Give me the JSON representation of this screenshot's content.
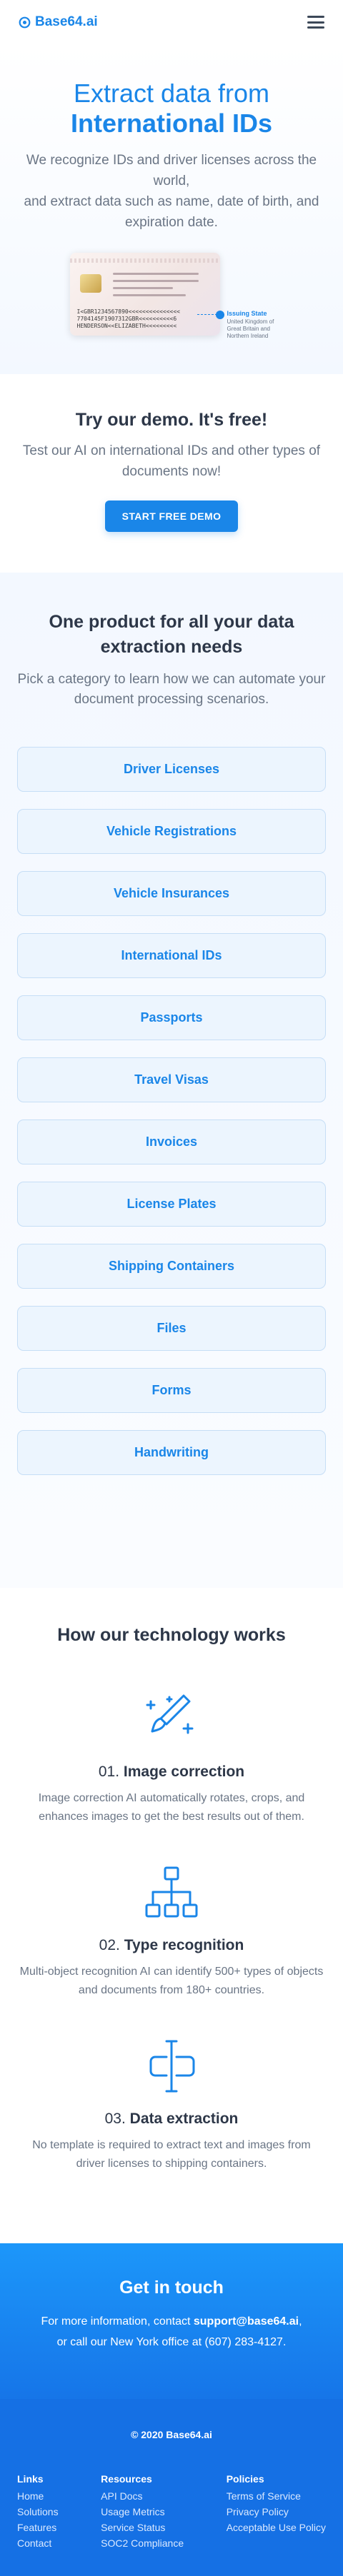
{
  "header": {
    "brand": "Base64.ai",
    "logo_icon": "base64-logo-icon",
    "menu_icon": "hamburger-menu-icon"
  },
  "hero": {
    "title_line1": "Extract data from",
    "title_line2": "International IDs",
    "description": "We recognize IDs and driver licenses across the world,\nand extract data such as name, date of birth, and expiration date.",
    "card": {
      "mrz_line1": "I<GBR1234567890<<<<<<<<<<<<<<<",
      "mrz_line2": "7704145F1907312GBR<<<<<<<<<<6",
      "mrz_line3": "HENDERSON<<ELIZABETH<<<<<<<<<",
      "callout_title": "Issuing State",
      "callout_text": "United Kingdom of Great Britain and Northern Ireland"
    }
  },
  "demo": {
    "title": "Try our demo. It's free!",
    "subtitle": "Test our AI on international IDs and other types of documents now!",
    "button": "START FREE DEMO"
  },
  "products": {
    "title": "One product for all your data extraction needs",
    "subtitle": "Pick a category to learn how we can automate your document processing scenarios.",
    "categories": [
      "Driver Licenses",
      "Vehicle Registrations",
      "Vehicle Insurances",
      "International IDs",
      "Passports",
      "Travel Visas",
      "Invoices",
      "License Plates",
      "Shipping Containers",
      "Files",
      "Forms",
      "Handwriting"
    ]
  },
  "tech": {
    "title": "How our technology works",
    "steps": [
      {
        "number": "01.",
        "name": "Image correction",
        "icon": "magic-wand-icon",
        "text": "Image correction AI automatically rotates, crops, and enhances images to get the best results out of them."
      },
      {
        "number": "02.",
        "name": "Type recognition",
        "icon": "hierarchy-icon",
        "text": "Multi-object recognition AI can identify 500+ types of objects and documents from 180+ countries."
      },
      {
        "number": "03.",
        "name": "Data extraction",
        "icon": "text-cursor-icon",
        "text": "No template is required to extract text and images from driver licenses to shipping containers."
      }
    ]
  },
  "contact": {
    "title": "Get in touch",
    "text_before": "For more information, contact ",
    "email": "support@base64.ai",
    "text_after": ",\nor call our New York office at (607) 283-4127."
  },
  "footer": {
    "copyright": "© 2020 Base64.ai",
    "columns": [
      {
        "title": "Links",
        "items": [
          "Home",
          "Solutions",
          "Features",
          "Contact"
        ]
      },
      {
        "title": "Resources",
        "items": [
          "API Docs",
          "Usage Metrics",
          "Service Status",
          "SOC2 Compliance"
        ]
      },
      {
        "title": "Policies",
        "items": [
          "Terms of Service",
          "Privacy Policy",
          "Acceptable Use Policy"
        ]
      }
    ]
  },
  "colors": {
    "accent": "#1a86e8",
    "text": "#2d3748",
    "muted": "#6a7585",
    "category_bg": "#ecf5fe",
    "footer_bg": "#1570e4"
  }
}
